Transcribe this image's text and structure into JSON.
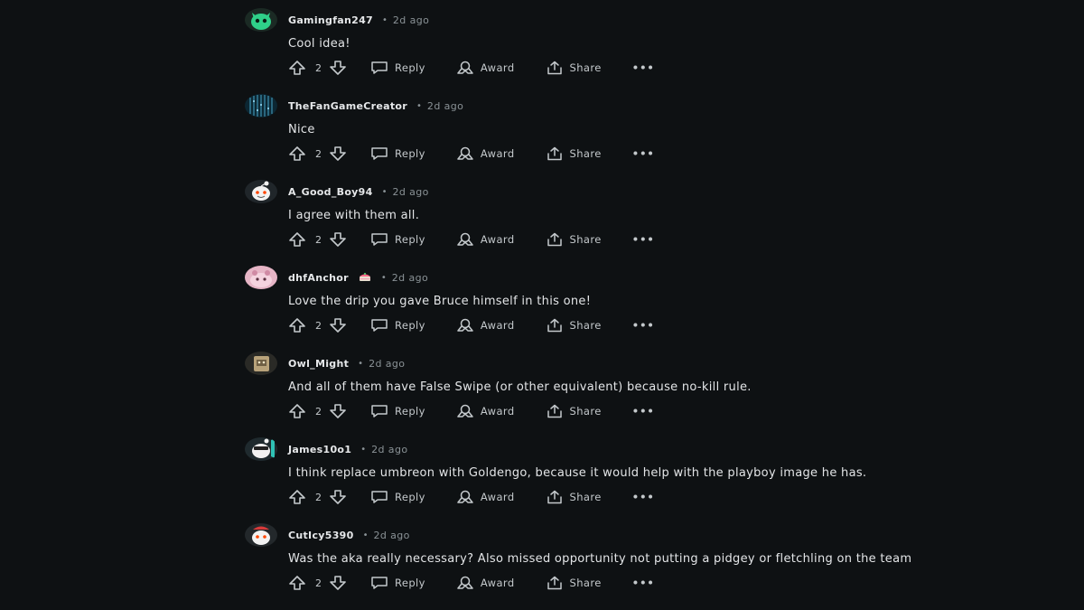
{
  "comments": [
    {
      "username": "Gamingfan247",
      "time": "2d ago",
      "text": "Cool idea!",
      "votes": "2"
    },
    {
      "username": "TheFanGameCreator",
      "time": "2d ago",
      "text": "Nice",
      "votes": "2"
    },
    {
      "username": "A_Good_Boy94",
      "time": "2d ago",
      "text": "I agree with them all.",
      "votes": "2"
    },
    {
      "username": "dhfAnchor",
      "time": "2d ago",
      "text": "Love the drip you gave Bruce himself in this one!",
      "votes": "2"
    },
    {
      "username": "Owl_Might",
      "time": "2d ago",
      "text": "And all of them have False Swipe (or other equivalent) because no-kill rule.",
      "votes": "2"
    },
    {
      "username": "James10o1",
      "time": "2d ago",
      "text": "I think replace umbreon with Goldengo, because it would help with the playboy image he has.",
      "votes": "2"
    },
    {
      "username": "CutIcy5390",
      "time": "2d ago",
      "text": "Was the aka really necessary? Also missed opportunity not putting a pidgey or fletchling on the team",
      "votes": "2"
    }
  ],
  "actions": {
    "reply": "Reply",
    "award": "Award",
    "share": "Share",
    "more": "•••",
    "separator": "•"
  },
  "icons": [
    "upvote-icon",
    "downvote-icon",
    "reply-icon",
    "award-icon",
    "share-icon",
    "more-icon"
  ],
  "colors": {
    "background": "#0e1113",
    "text": "#d7dadc",
    "muted": "#8a9296"
  }
}
